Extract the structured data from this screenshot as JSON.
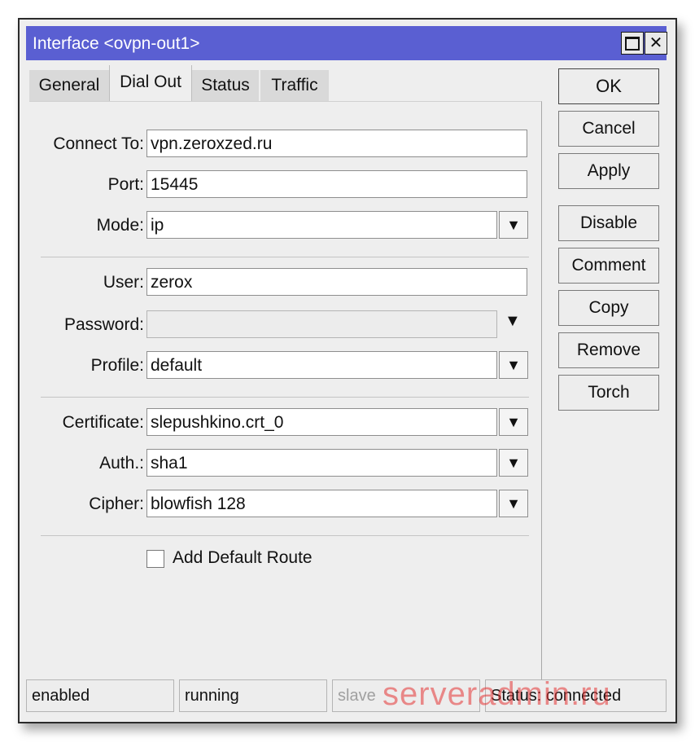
{
  "window": {
    "title": "Interface <ovpn-out1>",
    "maximize_icon": "maximize-icon",
    "close_icon": "close-icon",
    "close_glyph": "✕",
    "titlebar_color": "#5a5fd2"
  },
  "tabs": [
    {
      "label": "General"
    },
    {
      "label": "Dial Out",
      "active": true
    },
    {
      "label": "Status"
    },
    {
      "label": "Traffic"
    }
  ],
  "form": {
    "connect_to": {
      "label": "Connect To:",
      "value": "vpn.zeroxzed.ru"
    },
    "port": {
      "label": "Port:",
      "value": "15445"
    },
    "mode": {
      "label": "Mode:",
      "value": "ip"
    },
    "user": {
      "label": "User:",
      "value": "zerox"
    },
    "password": {
      "label": "Password:",
      "value": ""
    },
    "profile": {
      "label": "Profile:",
      "value": "default"
    },
    "certificate": {
      "label": "Certificate:",
      "value": "slepushkino.crt_0"
    },
    "auth": {
      "label": "Auth.:",
      "value": "sha1"
    },
    "cipher": {
      "label": "Cipher:",
      "value": "blowfish 128"
    },
    "add_default_route": {
      "label": "Add Default Route",
      "checked": false
    }
  },
  "buttons": {
    "ok": "OK",
    "cancel": "Cancel",
    "apply": "Apply",
    "disable": "Disable",
    "comment": "Comment",
    "copy": "Copy",
    "remove": "Remove",
    "torch": "Torch"
  },
  "statusbar": {
    "enabled": "enabled",
    "running": "running",
    "slave": "slave",
    "status": "Status: connected"
  },
  "watermark": "serveradmin.ru",
  "icons": {
    "dropdown": "▼"
  }
}
